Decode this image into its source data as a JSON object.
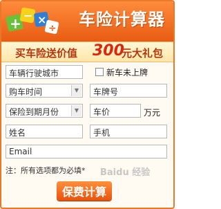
{
  "header": {
    "title": "车险计算器",
    "icon": "calculator-symbols-icon"
  },
  "banner": {
    "pre": "买车险送价值",
    "amount": "300",
    "post": "元大礼包"
  },
  "form": {
    "city": "车辆行驶城市",
    "new_car_label": "新车未上牌",
    "purchase_time": "购车时间",
    "plate_number": "车牌号",
    "expiry_month": "保险到期月份",
    "car_price": "车价",
    "price_unit": "万元",
    "name": "姓名",
    "phone": "手机",
    "email": "Email"
  },
  "note": "注：所有选项都为必填*",
  "submit_label": "保费计算",
  "watermark": "Baidu 经验",
  "colors": {
    "brand_orange": "#e85c12",
    "banner_text": "#d8290d"
  }
}
